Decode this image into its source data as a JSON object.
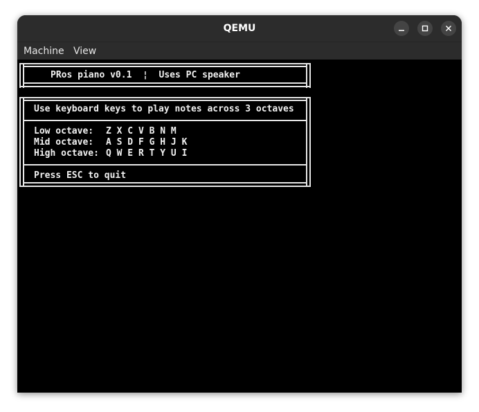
{
  "window": {
    "title": "QEMU",
    "minimize_symbol": "–",
    "maximize_symbol": "□",
    "close_symbol": "✕"
  },
  "menubar": {
    "items": [
      {
        "label": "Machine"
      },
      {
        "label": "View"
      }
    ]
  },
  "console": {
    "header": "PRos piano v0.1  ¦  Uses PC speaker",
    "instruction": "Use keyboard keys to play notes across 3 octaves",
    "octaves": [
      {
        "label": "Low octave:",
        "keys": "Z X C V B N M"
      },
      {
        "label": "Mid octave:",
        "keys": "A S D F G H J K"
      },
      {
        "label": "High octave:",
        "keys": "Q W E R T Y U I"
      }
    ],
    "quit_hint": "Press ESC to quit",
    "colors": {
      "foreground": "#f2f2f2",
      "background": "#000000"
    }
  }
}
